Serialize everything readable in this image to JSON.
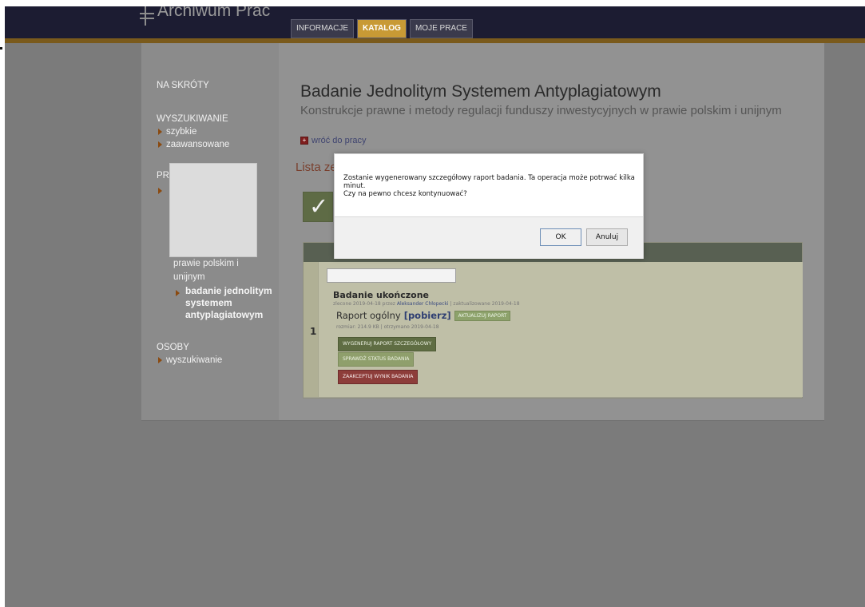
{
  "window": {
    "logo": {
      "title": "Archiwum Prac",
      "icon": "archive-column-icon"
    },
    "tabs": [
      {
        "label": "INFORMACJE",
        "active": false
      },
      {
        "label": "KATALOG",
        "active": true
      },
      {
        "label": "MOJE PRACE",
        "active": false
      }
    ]
  },
  "sidebar": {
    "shortcuts": "NA SKRÓTY",
    "search_heading": "WYSZUKIWANIE",
    "search_items": [
      "szybkie",
      "zaawansowane"
    ],
    "partial_heading": "PR",
    "partial_lines": [
      "prawie polskim i",
      "unijnym"
    ],
    "bold_item_lines": [
      "badanie jednolitym",
      "systemem",
      "antyplagiatowym"
    ],
    "people_heading": "OSOBY",
    "people_items": [
      "wyszukiwanie"
    ]
  },
  "main": {
    "title": "Badanie Jednolitym Systemem Antyplagiatowym",
    "subtitle": "Konstrukcje prawne i metody regulacji funduszy inwestycyjnych w prawie polskim i unijnym",
    "back_link": "wróć do pracy",
    "list_heading": "Lista ze",
    "row": {
      "number": "1",
      "status": "Badanie ukończone",
      "meta_prefix": "zlecone 2019-04-18 przez",
      "meta_user": "Aleksander Chłopecki",
      "meta_suffix": "| zaktualizowane 2019-04-18",
      "report_label": "Raport ogólny",
      "report_link": "[pobierz]",
      "update_button": "AKTUALIZUJ RAPORT",
      "size_info": "rozmiar: 214.9 KB | otrzymano 2019-04-18",
      "buttons": {
        "generate": "WYGENERUJ RAPORT SZCZEGÓŁOWY",
        "check_status": "SPRAWDŹ STATUS BADANIA",
        "accept": "ZAAKCEPTUJ WYNIK BADANIA"
      }
    }
  },
  "dialog": {
    "message_line1": "Zostanie wygenerowany szczegółowy raport badania. Ta operacja może potrwać kilka minut.",
    "message_line2": "Czy na pewno chcesz kontynuować?",
    "ok_label": "OK",
    "cancel_label": "Anuluj"
  },
  "colors": {
    "accent_tab": "#c89a35",
    "header_bg": "#1c1c32",
    "button_dark": "#5f6d43",
    "button_red": "#8d3d3a"
  }
}
